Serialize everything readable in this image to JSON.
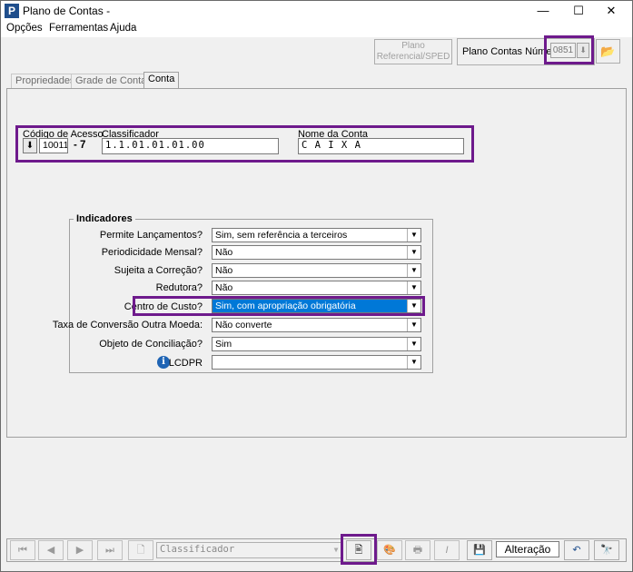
{
  "window": {
    "title": "Plano de Contas -",
    "app_icon": "P",
    "controls": {
      "minimize": "—",
      "maximize": "☐",
      "close": "✕"
    }
  },
  "menu": [
    "Opções",
    "Ferramentas",
    "Ajuda"
  ],
  "header": {
    "ref_button_line1": "Plano",
    "ref_button_line2": "Referencial/SPED",
    "plano_label": "Plano Contas Número",
    "plano_value": "0851",
    "open_icon": "folder-open-icon"
  },
  "tabs": [
    {
      "label": "Propriedades",
      "active": false
    },
    {
      "label": "Grade de Contas",
      "active": false
    },
    {
      "label": "Conta",
      "active": true
    }
  ],
  "account": {
    "codigo_label": "Código de Acesso",
    "codigo_value": "10011",
    "codigo_digit": "- 7",
    "classificador_label": "Classificador",
    "classificador_value": "1.1.01.01.01.00",
    "nome_label": "Nome da Conta",
    "nome_value": "C A I X A"
  },
  "indicadores": {
    "title": "Indicadores",
    "rows": [
      {
        "label": "Permite Lançamentos?",
        "value": "Sim, sem referência a terceiros"
      },
      {
        "label": "Periodicidade Mensal?",
        "value": "Não"
      },
      {
        "label": "Sujeita a Correção?",
        "value": "Não"
      },
      {
        "label": "Redutora?",
        "value": "Não"
      },
      {
        "label": "Centro de Custo?",
        "value": "Sim, com apropriação obrigatória"
      },
      {
        "label": "Taxa de Conversão Outra Moeda:",
        "value": "Não converte"
      },
      {
        "label": "Objeto de Conciliação?",
        "value": "Sim"
      },
      {
        "label": "LCDPR",
        "value": ""
      }
    ]
  },
  "toolbar": {
    "combo_value": "Classificador",
    "status": "Alteração"
  },
  "colors": {
    "highlight": "#6e1a8c",
    "selection": "#0078d7"
  }
}
